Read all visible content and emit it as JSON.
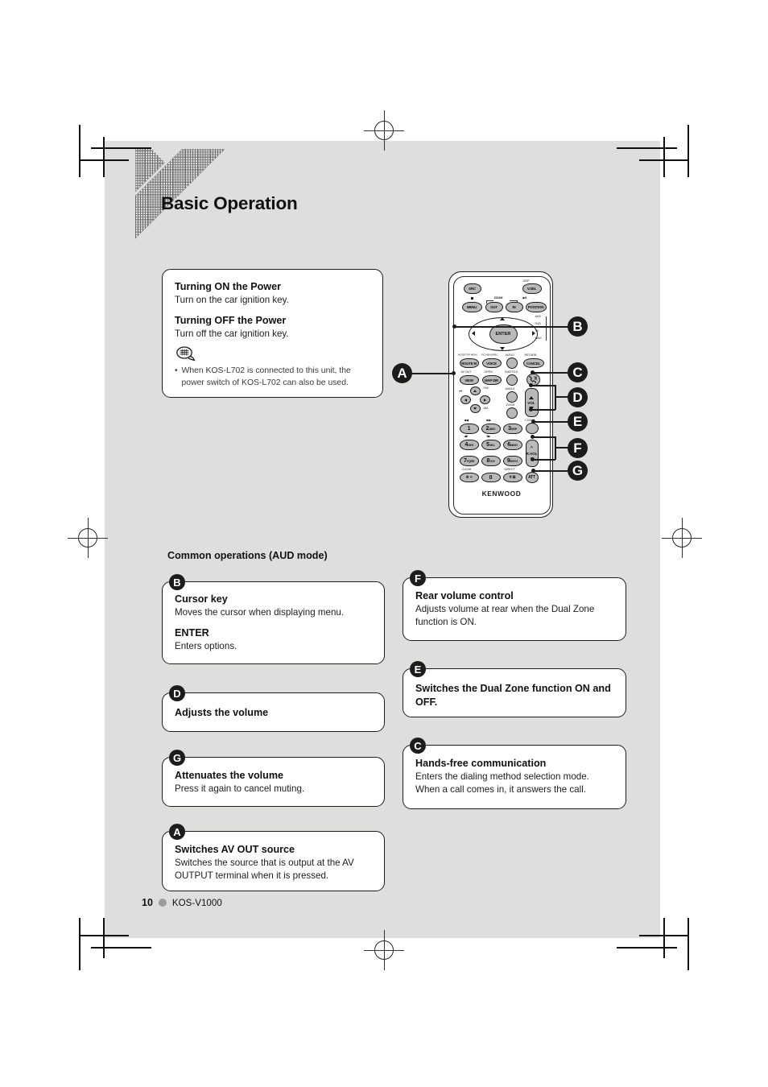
{
  "page": {
    "title": "Basic Operation",
    "number": "10",
    "model": "KOS-V1000"
  },
  "power_box": {
    "on_title": "Turning ON the Power",
    "on_text": "Turn on the car ignition key.",
    "off_title": "Turning OFF the Power",
    "off_text": "Turn off the car ignition key.",
    "note_icon": "note-balloon-icon",
    "note_bullet": "•",
    "note_text": "When KOS-L702 is connected to this unit, the power switch of KOS-L702 can also be used."
  },
  "section": {
    "label": "Common operations (AUD mode)"
  },
  "callouts": {
    "b": {
      "badge": "B",
      "title1": "Cursor key",
      "text1": "Moves the cursor when displaying menu.",
      "title2": "ENTER",
      "text2": "Enters options."
    },
    "d": {
      "badge": "D",
      "title1": "Adjusts the volume"
    },
    "g": {
      "badge": "G",
      "title1": "Attenuates the volume",
      "text1": "Press it again to cancel muting."
    },
    "a": {
      "badge": "A",
      "title1": "Switches AV OUT source",
      "text1": "Switches the source that is output at the AV OUTPUT terminal when it is pressed."
    },
    "f": {
      "badge": "F",
      "title1": "Rear volume control",
      "text1": "Adjusts volume at rear when the Dual Zone function is ON."
    },
    "e": {
      "badge": "E",
      "title1": "Switches the Dual Zone function ON and OFF."
    },
    "c": {
      "badge": "C",
      "title1": "Hands-free communication",
      "text1": "Enters the dialing method selection mode.",
      "text2": "When a call comes in, it answers the call."
    }
  },
  "remote": {
    "brand": "KENWOOD",
    "buttons": {
      "src": "SRC",
      "vsel": "V.SEL",
      "disp": "DISP",
      "menu": "MENU",
      "zoom": "ZOOM",
      "out": "OUT",
      "in": "IN",
      "position": "POSITION",
      "enter": "ENTER",
      "aud": "AUD",
      "dvd": "DVD",
      "tv": "TV",
      "navi": "NAVI",
      "routem_top": "MODE/TOP MENU",
      "routem": "ROUTE M",
      "voice_top": "PIC.MENU/PBC",
      "voice": "VOICE",
      "audio_top": "AUDIO",
      "return_top": "RETURN",
      "cancel": "CANCEL",
      "avout": "AV OUT",
      "view": "VIEW",
      "open": "OPEN",
      "mapdir": "MAP DIR",
      "subtitle": "SUBTITLE",
      "phone": "phone-icon",
      "angle": "ANGLE",
      "zoom2": "ZOOM",
      "vol": "VOL",
      "zone2": "2 ZONE",
      "rvol": "R.VOL",
      "att": "ATT",
      "fm": "FM+",
      "am": "AM-",
      "prev": "◀◀",
      "next": "▶▶",
      "trk_prev": "⏮",
      "trk_next": "⏭",
      "pause_l": "◀II",
      "pause_r": "II▶",
      "clear": "CLEAR",
      "direct": "DIRECT",
      "k1": "1",
      "k2": "2",
      "k2s": "ABC",
      "k3": "3",
      "k3s": "DEF",
      "k4": "4",
      "k4s": "GHI",
      "k5": "5",
      "k5s": "JKL",
      "k6": "6",
      "k6s": "MNO",
      "k7": "7",
      "k7s": "PQRS",
      "k8": "8",
      "k8s": "TUV",
      "k9": "9",
      "k9s": "WXYZ",
      "k0": "0",
      "kstar": "✳ +",
      "khash": "# ⊞"
    },
    "callout_labels": [
      "A",
      "B",
      "C",
      "D",
      "E",
      "F",
      "G"
    ]
  }
}
